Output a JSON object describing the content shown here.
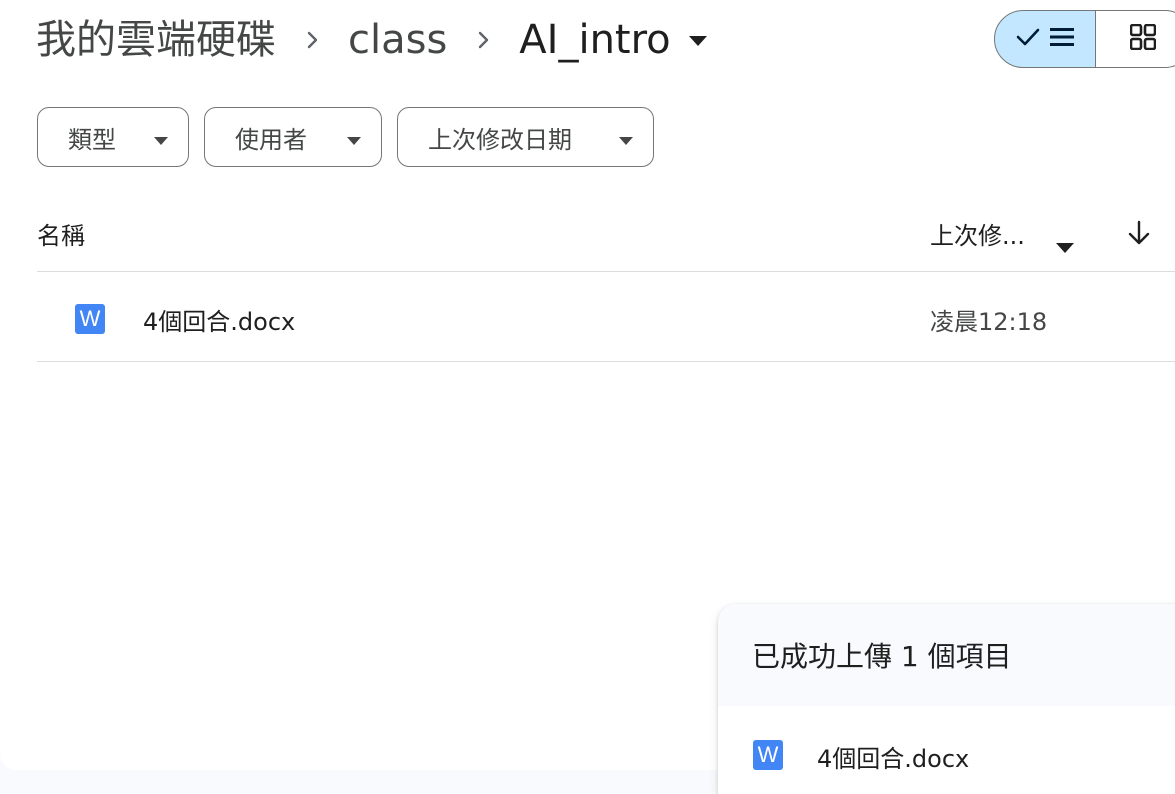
{
  "breadcrumb": {
    "root": "我的雲端硬碟",
    "parent": "class",
    "current": "AI_intro",
    "separator_icon": "chevron-right-icon",
    "current_menu_icon": "arrow-drop-down-icon"
  },
  "view_toggle": {
    "list_selected": true,
    "list_icons": [
      "check-icon",
      "list-icon"
    ],
    "grid_icon": "grid-icon",
    "selected_color": "#c2e7ff"
  },
  "filters": [
    {
      "label": "類型"
    },
    {
      "label": "使用者"
    },
    {
      "label": "上次修改日期"
    }
  ],
  "columns": {
    "name": "名稱",
    "modified": "上次修...",
    "sort_direction_icon": "arrow-downward-icon"
  },
  "files": [
    {
      "icon": "word-doc-icon",
      "icon_letter": "W",
      "name": "4個回合.docx",
      "modified": "凌晨12:18"
    }
  ],
  "upload_panel": {
    "title": "已成功上傳 1 個項目",
    "items": [
      {
        "icon": "word-doc-icon",
        "icon_letter": "W",
        "name": "4個回合.docx"
      }
    ]
  },
  "colors": {
    "word_blue": "#4285f4",
    "outline": "#747775",
    "divider": "#dadce0"
  }
}
